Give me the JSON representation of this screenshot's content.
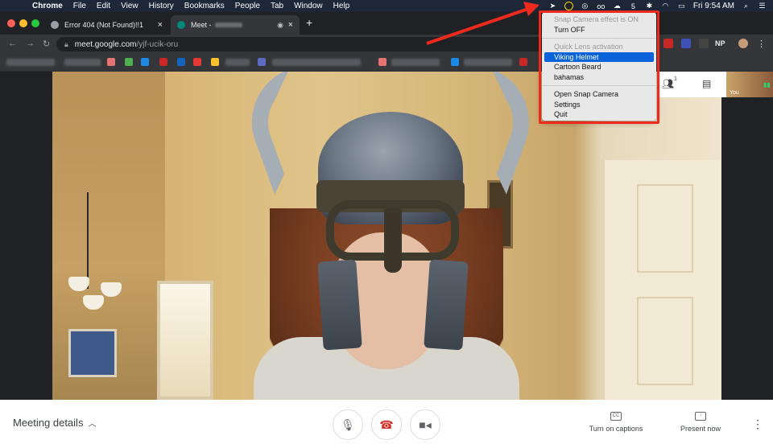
{
  "menubar": {
    "app": "Chrome",
    "items": [
      "File",
      "Edit",
      "View",
      "History",
      "Bookmarks",
      "People",
      "Tab",
      "Window",
      "Help"
    ],
    "clock": "Fri 9:54 AM"
  },
  "tabs": [
    {
      "title": "Error 404 (Not Found)!!1"
    },
    {
      "title": "Meet -"
    }
  ],
  "address": {
    "host": "meet.google.com",
    "path": "/yjf-ucik-oru"
  },
  "toolbar_ext": {
    "label": "NP"
  },
  "snap_menu": {
    "status": "Snap Camera effect is ON",
    "toggle": "Turn OFF",
    "section": "Quick Lens activation",
    "lenses": [
      "Viking Helmet",
      "Cartoon Beard",
      "bahamas"
    ],
    "actions": [
      "Open Snap Camera",
      "Settings",
      "Quit"
    ]
  },
  "participants": {
    "count": "1"
  },
  "self_view": {
    "label": "You"
  },
  "bottom": {
    "meeting_details": "Meeting details",
    "captions": "Turn on captions",
    "captions_icon": "CC",
    "present": "Present now"
  },
  "colors": {
    "highlight": "#0a63d8",
    "annotation": "#ee2a1e",
    "hangup": "#d93025"
  }
}
